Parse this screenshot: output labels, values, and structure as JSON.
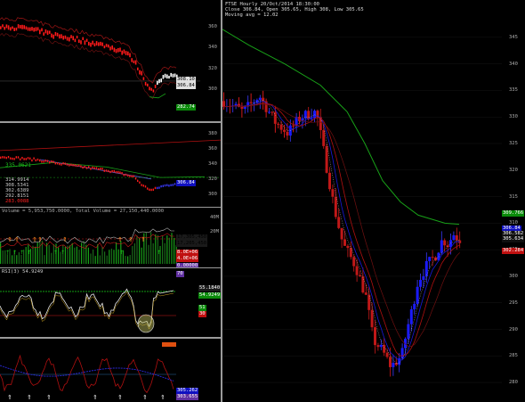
{
  "main": {
    "header_line1": "FTSE  Hourly  20/Oct/2014 18:30:00",
    "header_line2": "Close 306.84, Open 305.65, High 308, Low 305.65",
    "header_line3": "Moving avg = 12.02",
    "yticks": [
      345,
      340,
      335,
      330,
      325,
      320,
      315,
      310,
      305,
      300,
      295,
      290,
      285,
      280
    ],
    "ylim": [
      278,
      348
    ],
    "price_tags": [
      "309.766",
      "306.84",
      "306.582",
      "305.634",
      "302.284"
    ],
    "tag_colors": [
      "#0a8a0a",
      "#1010c0",
      "#101010",
      "#101010",
      "#c01010"
    ]
  },
  "p1": {
    "yticks": [
      360,
      340,
      320,
      300
    ],
    "tags": [
      "308.10",
      "306.84",
      "282.74"
    ],
    "tag_colors": [
      "#e0e0e0",
      "#e0e0e0",
      "#0a8a0a"
    ]
  },
  "p2": {
    "yticks": [
      380,
      360,
      340,
      320,
      300
    ],
    "left_label": "335.0621",
    "left_values": [
      "314.9914",
      "308.5341",
      "302.6389",
      "292.8151",
      "283.0088"
    ],
    "tag": "306.84"
  },
  "p3": {
    "header": "Volume = 5,953,750.0000,  Total Volume = 27,150,440.0000",
    "yticks": [
      "40M",
      "20M"
    ],
    "tags": [
      "17,305,450",
      "17,205,450",
      "8.0E+06",
      "4.0E+06",
      "0.00000"
    ],
    "tag_colors": [
      "#1a1a1a",
      "#1a1a1a",
      "#c01010",
      "#c01010",
      "#6030a0"
    ]
  },
  "p4": {
    "header": "RSI(3) 54.9249",
    "top_label": "70",
    "tags": [
      "55.1840",
      "54.9249",
      "51",
      "30"
    ],
    "tag_colors": [
      "#1a1a1a",
      "#0a8a0a",
      "#0a8a0a",
      "#c01010"
    ]
  },
  "p5": {
    "tags": [
      "305.262",
      "303.655"
    ],
    "tag_colors": [
      "#1010c0",
      "#6030a0"
    ]
  },
  "chart_data": {
    "type": "candlestick",
    "title": "FTSE  Hourly  20/Oct/2014 18:30:00",
    "ylabel": "",
    "ylim": [
      278,
      348
    ],
    "series": [
      {
        "values": [
          306.84
        ]
      },
      {
        "values": [
          309.766
        ]
      }
    ]
  }
}
